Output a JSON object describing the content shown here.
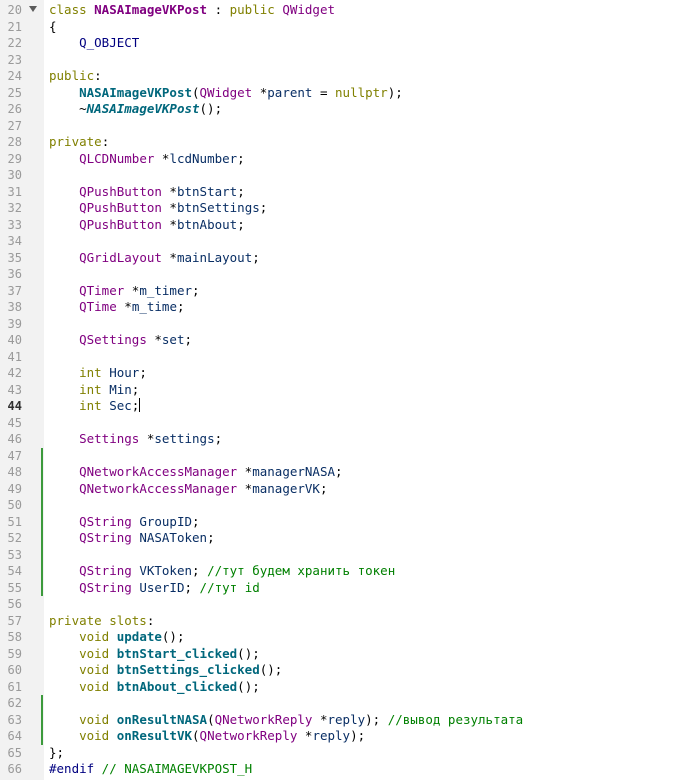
{
  "editor": {
    "current_line": 44,
    "lines": [
      {
        "n": "20",
        "tokens": [
          {
            "t": "class ",
            "c": "kw"
          },
          {
            "t": "NASAImageVKPost",
            "c": "cls"
          },
          {
            "t": " : ",
            "c": ""
          },
          {
            "t": "public ",
            "c": "kw"
          },
          {
            "t": "QWidget",
            "c": "ty"
          }
        ]
      },
      {
        "n": "21",
        "tokens": [
          {
            "t": "{",
            "c": ""
          }
        ]
      },
      {
        "n": "22",
        "tokens": [
          {
            "t": "    Q_OBJECT",
            "c": "pp"
          }
        ]
      },
      {
        "n": "23",
        "tokens": []
      },
      {
        "n": "24",
        "tokens": [
          {
            "t": "public",
            "c": "kw"
          },
          {
            "t": ":",
            "c": ""
          }
        ]
      },
      {
        "n": "25",
        "tokens": [
          {
            "t": "    ",
            "c": ""
          },
          {
            "t": "NASAImageVKPost",
            "c": "fnb"
          },
          {
            "t": "(",
            "c": ""
          },
          {
            "t": "QWidget",
            "c": "ty"
          },
          {
            "t": " *",
            "c": ""
          },
          {
            "t": "parent",
            "c": "vr"
          },
          {
            "t": " = ",
            "c": ""
          },
          {
            "t": "nullptr",
            "c": "kw"
          },
          {
            "t": ");",
            "c": ""
          }
        ]
      },
      {
        "n": "26",
        "tokens": [
          {
            "t": "    ~",
            "c": ""
          },
          {
            "t": "NASAImageVKPost",
            "c": "dtor"
          },
          {
            "t": "();",
            "c": ""
          }
        ]
      },
      {
        "n": "27",
        "tokens": []
      },
      {
        "n": "28",
        "tokens": [
          {
            "t": "private",
            "c": "kw"
          },
          {
            "t": ":",
            "c": ""
          }
        ]
      },
      {
        "n": "29",
        "tokens": [
          {
            "t": "    ",
            "c": ""
          },
          {
            "t": "QLCDNumber",
            "c": "ty"
          },
          {
            "t": " *",
            "c": ""
          },
          {
            "t": "lcdNumber",
            "c": "vr"
          },
          {
            "t": ";",
            "c": ""
          }
        ]
      },
      {
        "n": "30",
        "tokens": []
      },
      {
        "n": "31",
        "tokens": [
          {
            "t": "    ",
            "c": ""
          },
          {
            "t": "QPushButton",
            "c": "ty"
          },
          {
            "t": " *",
            "c": ""
          },
          {
            "t": "btnStart",
            "c": "vr"
          },
          {
            "t": ";",
            "c": ""
          }
        ]
      },
      {
        "n": "32",
        "tokens": [
          {
            "t": "    ",
            "c": ""
          },
          {
            "t": "QPushButton",
            "c": "ty"
          },
          {
            "t": " *",
            "c": ""
          },
          {
            "t": "btnSettings",
            "c": "vr"
          },
          {
            "t": ";",
            "c": ""
          }
        ]
      },
      {
        "n": "33",
        "tokens": [
          {
            "t": "    ",
            "c": ""
          },
          {
            "t": "QPushButton",
            "c": "ty"
          },
          {
            "t": " *",
            "c": ""
          },
          {
            "t": "btnAbout",
            "c": "vr"
          },
          {
            "t": ";",
            "c": ""
          }
        ]
      },
      {
        "n": "34",
        "tokens": []
      },
      {
        "n": "35",
        "tokens": [
          {
            "t": "    ",
            "c": ""
          },
          {
            "t": "QGridLayout",
            "c": "ty"
          },
          {
            "t": " *",
            "c": ""
          },
          {
            "t": "mainLayout",
            "c": "vr"
          },
          {
            "t": ";",
            "c": ""
          }
        ]
      },
      {
        "n": "36",
        "tokens": []
      },
      {
        "n": "37",
        "tokens": [
          {
            "t": "    ",
            "c": ""
          },
          {
            "t": "QTimer",
            "c": "ty"
          },
          {
            "t": " *",
            "c": ""
          },
          {
            "t": "m_timer",
            "c": "vr"
          },
          {
            "t": ";",
            "c": ""
          }
        ]
      },
      {
        "n": "38",
        "tokens": [
          {
            "t": "    ",
            "c": ""
          },
          {
            "t": "QTime",
            "c": "ty"
          },
          {
            "t": " *",
            "c": ""
          },
          {
            "t": "m_time",
            "c": "vr"
          },
          {
            "t": ";",
            "c": ""
          }
        ]
      },
      {
        "n": "39",
        "tokens": []
      },
      {
        "n": "40",
        "tokens": [
          {
            "t": "    ",
            "c": ""
          },
          {
            "t": "QSettings",
            "c": "ty"
          },
          {
            "t": " *",
            "c": ""
          },
          {
            "t": "set",
            "c": "vr"
          },
          {
            "t": ";",
            "c": ""
          }
        ]
      },
      {
        "n": "41",
        "tokens": []
      },
      {
        "n": "42",
        "tokens": [
          {
            "t": "    ",
            "c": ""
          },
          {
            "t": "int",
            "c": "kw"
          },
          {
            "t": " ",
            "c": ""
          },
          {
            "t": "Hour",
            "c": "vr"
          },
          {
            "t": ";",
            "c": ""
          }
        ]
      },
      {
        "n": "43",
        "tokens": [
          {
            "t": "    ",
            "c": ""
          },
          {
            "t": "int",
            "c": "kw"
          },
          {
            "t": " ",
            "c": ""
          },
          {
            "t": "Min",
            "c": "vr"
          },
          {
            "t": ";",
            "c": ""
          }
        ]
      },
      {
        "n": "44",
        "tokens": [
          {
            "t": "    ",
            "c": ""
          },
          {
            "t": "int",
            "c": "kw"
          },
          {
            "t": " ",
            "c": ""
          },
          {
            "t": "Sec",
            "c": "vr"
          },
          {
            "t": ";",
            "c": ""
          }
        ],
        "cursor": true
      },
      {
        "n": "45",
        "tokens": []
      },
      {
        "n": "46",
        "tokens": [
          {
            "t": "    ",
            "c": ""
          },
          {
            "t": "Settings",
            "c": "ty"
          },
          {
            "t": " *",
            "c": ""
          },
          {
            "t": "settings",
            "c": "vr"
          },
          {
            "t": ";",
            "c": ""
          }
        ]
      },
      {
        "n": "47",
        "tokens": []
      },
      {
        "n": "48",
        "tokens": [
          {
            "t": "    ",
            "c": ""
          },
          {
            "t": "QNetworkAccessManager",
            "c": "ty"
          },
          {
            "t": " *",
            "c": ""
          },
          {
            "t": "managerNASA",
            "c": "vr"
          },
          {
            "t": ";",
            "c": ""
          }
        ]
      },
      {
        "n": "49",
        "tokens": [
          {
            "t": "    ",
            "c": ""
          },
          {
            "t": "QNetworkAccessManager",
            "c": "ty"
          },
          {
            "t": " *",
            "c": ""
          },
          {
            "t": "managerVK",
            "c": "vr"
          },
          {
            "t": ";",
            "c": ""
          }
        ]
      },
      {
        "n": "50",
        "tokens": []
      },
      {
        "n": "51",
        "tokens": [
          {
            "t": "    ",
            "c": ""
          },
          {
            "t": "QString",
            "c": "ty"
          },
          {
            "t": " ",
            "c": ""
          },
          {
            "t": "GroupID",
            "c": "vr"
          },
          {
            "t": ";",
            "c": ""
          }
        ]
      },
      {
        "n": "52",
        "tokens": [
          {
            "t": "    ",
            "c": ""
          },
          {
            "t": "QString",
            "c": "ty"
          },
          {
            "t": " ",
            "c": ""
          },
          {
            "t": "NASAToken",
            "c": "vr"
          },
          {
            "t": ";",
            "c": ""
          }
        ]
      },
      {
        "n": "53",
        "tokens": []
      },
      {
        "n": "54",
        "tokens": [
          {
            "t": "    ",
            "c": ""
          },
          {
            "t": "QString",
            "c": "ty"
          },
          {
            "t": " ",
            "c": ""
          },
          {
            "t": "VKToken",
            "c": "vr"
          },
          {
            "t": "; ",
            "c": ""
          },
          {
            "t": "//тут будем хранить токен",
            "c": "cm"
          }
        ]
      },
      {
        "n": "55",
        "tokens": [
          {
            "t": "    ",
            "c": ""
          },
          {
            "t": "QString",
            "c": "ty"
          },
          {
            "t": " ",
            "c": ""
          },
          {
            "t": "UserID",
            "c": "vr"
          },
          {
            "t": "; ",
            "c": ""
          },
          {
            "t": "//тут id",
            "c": "cm"
          }
        ]
      },
      {
        "n": "56",
        "tokens": []
      },
      {
        "n": "57",
        "tokens": [
          {
            "t": "private slots",
            "c": "kw"
          },
          {
            "t": ":",
            "c": ""
          }
        ]
      },
      {
        "n": "58",
        "tokens": [
          {
            "t": "    ",
            "c": ""
          },
          {
            "t": "void",
            "c": "kw"
          },
          {
            "t": " ",
            "c": ""
          },
          {
            "t": "update",
            "c": "fnb"
          },
          {
            "t": "();",
            "c": ""
          }
        ]
      },
      {
        "n": "59",
        "tokens": [
          {
            "t": "    ",
            "c": ""
          },
          {
            "t": "void",
            "c": "kw"
          },
          {
            "t": " ",
            "c": ""
          },
          {
            "t": "btnStart_clicked",
            "c": "fnb"
          },
          {
            "t": "();",
            "c": ""
          }
        ]
      },
      {
        "n": "60",
        "tokens": [
          {
            "t": "    ",
            "c": ""
          },
          {
            "t": "void",
            "c": "kw"
          },
          {
            "t": " ",
            "c": ""
          },
          {
            "t": "btnSettings_clicked",
            "c": "fnb"
          },
          {
            "t": "();",
            "c": ""
          }
        ]
      },
      {
        "n": "61",
        "tokens": [
          {
            "t": "    ",
            "c": ""
          },
          {
            "t": "void",
            "c": "kw"
          },
          {
            "t": " ",
            "c": ""
          },
          {
            "t": "btnAbout_clicked",
            "c": "fnb"
          },
          {
            "t": "();",
            "c": ""
          }
        ]
      },
      {
        "n": "62",
        "tokens": []
      },
      {
        "n": "63",
        "tokens": [
          {
            "t": "    ",
            "c": ""
          },
          {
            "t": "void",
            "c": "kw"
          },
          {
            "t": " ",
            "c": ""
          },
          {
            "t": "onResultNASA",
            "c": "fnb"
          },
          {
            "t": "(",
            "c": ""
          },
          {
            "t": "QNetworkReply",
            "c": "ty"
          },
          {
            "t": " *",
            "c": ""
          },
          {
            "t": "reply",
            "c": "vr"
          },
          {
            "t": "); ",
            "c": ""
          },
          {
            "t": "//вывод результата",
            "c": "cm"
          }
        ]
      },
      {
        "n": "64",
        "tokens": [
          {
            "t": "    ",
            "c": ""
          },
          {
            "t": "void",
            "c": "kw"
          },
          {
            "t": " ",
            "c": ""
          },
          {
            "t": "onResultVK",
            "c": "fnb"
          },
          {
            "t": "(",
            "c": ""
          },
          {
            "t": "QNetworkReply",
            "c": "ty"
          },
          {
            "t": " *",
            "c": ""
          },
          {
            "t": "reply",
            "c": "vr"
          },
          {
            "t": ");",
            "c": ""
          }
        ]
      },
      {
        "n": "65",
        "tokens": [
          {
            "t": "};",
            "c": ""
          }
        ]
      },
      {
        "n": "66",
        "tokens": [
          {
            "t": "#endif",
            "c": "pp"
          },
          {
            "t": " // NASAIMAGEVKPOST_H",
            "c": "cm"
          }
        ]
      }
    ],
    "modified_ranges": [
      [
        "47",
        "55"
      ],
      [
        "62",
        "64"
      ]
    ],
    "folded_lines": [
      "20"
    ],
    "colors": {
      "keyword": "#808000",
      "type": "#800080",
      "function": "#00677c",
      "variable": "#092e64",
      "comment": "#008000",
      "preprocessor": "#000080",
      "modified_marker": "#3c9a3c"
    }
  }
}
